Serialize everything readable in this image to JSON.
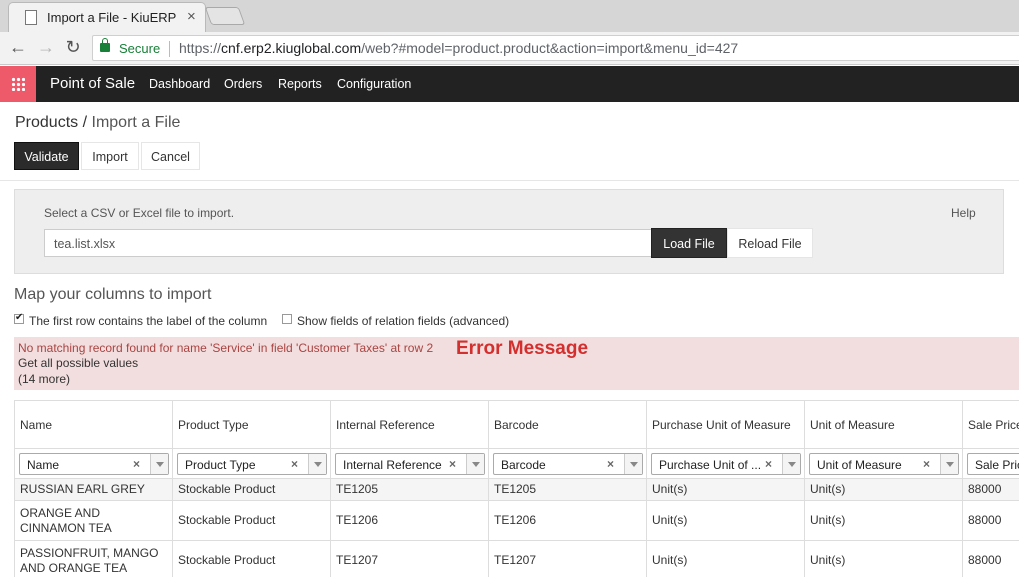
{
  "browser": {
    "tab_title": "Import a File - KiuERP",
    "tab_close": "×",
    "back": "←",
    "forward": "→",
    "reload": "↻",
    "secure_label": "Secure",
    "url_scheme": "https://",
    "url_host": "cnf.erp2.kiuglobal.com",
    "url_rest": "/web?#model=product.product&action=import&menu_id=427"
  },
  "app": {
    "name": "Point of Sale",
    "menu": [
      "Dashboard",
      "Orders",
      "Reports",
      "Configuration"
    ],
    "brand_color": "#ef5a6a"
  },
  "breadcrumb": {
    "parent": "Products",
    "separator": "/",
    "current": "Import a File"
  },
  "actions": {
    "validate": "Validate",
    "import": "Import",
    "cancel": "Cancel"
  },
  "file": {
    "select_label": "Select a CSV or Excel file to import.",
    "help": "Help",
    "filename": "tea.list.xlsx",
    "load": "Load File",
    "reload": "Reload File"
  },
  "mapping": {
    "title": "Map your columns to import",
    "first_row_label": "The first row contains the label of the column",
    "first_row_checked": true,
    "relation_label": "Show fields of relation fields (advanced)",
    "relation_checked": false
  },
  "error": {
    "message": "No matching record found for name 'Service' in field 'Customer Taxes' at row 2",
    "values_link": "Get all possible values",
    "more": "(14 more)",
    "annotation": "Error Message",
    "annotation_color": "#d32f2f"
  },
  "table": {
    "headers": [
      "Name",
      "Product Type",
      "Internal Reference",
      "Barcode",
      "Purchase Unit of Measure",
      "Unit of Measure",
      "Sale Price"
    ],
    "selects": [
      "Name",
      "Product Type",
      "Internal Reference",
      "Barcode",
      "Purchase Unit of ...",
      "Unit of Measure",
      "Sale Pric"
    ],
    "rows": [
      [
        "RUSSIAN EARL GREY",
        "Stockable Product",
        "TE1205",
        "TE1205",
        "Unit(s)",
        "Unit(s)",
        "88000"
      ],
      [
        "ORANGE AND CINNAMON TEA",
        "Stockable Product",
        "TE1206",
        "TE1206",
        "Unit(s)",
        "Unit(s)",
        "88000"
      ],
      [
        "PASSIONFRUIT, MANGO AND ORANGE TEA",
        "Stockable Product",
        "TE1207",
        "TE1207",
        "Unit(s)",
        "Unit(s)",
        "88000"
      ]
    ]
  }
}
